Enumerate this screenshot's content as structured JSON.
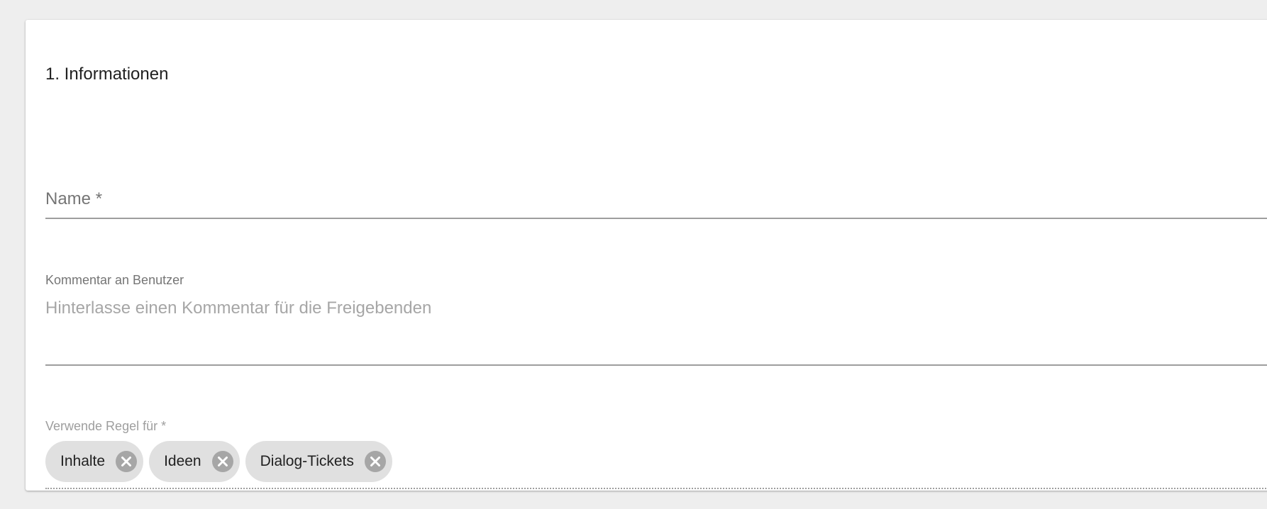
{
  "section": {
    "title": "1. Informationen"
  },
  "name_field": {
    "label": "Name *",
    "value": ""
  },
  "comment_field": {
    "label": "Kommentar an Benutzer",
    "placeholder": "Hinterlasse einen Kommentar für die Freigebenden",
    "value": ""
  },
  "rule_field": {
    "label": "Verwende Regel für *",
    "chips": [
      {
        "label": "Inhalte",
        "remove_icon": "cancel-circle-icon"
      },
      {
        "label": "Ideen",
        "remove_icon": "cancel-circle-icon"
      },
      {
        "label": "Dialog-Tickets",
        "remove_icon": "cancel-circle-icon"
      }
    ]
  },
  "colors": {
    "page_background": "#eeeeee",
    "card_background": "#ffffff",
    "chip_background": "#e0e0e0",
    "chip_remove_icon": "#a6a6a6",
    "label_text": "#757575",
    "placeholder_text": "#a6a6a6"
  }
}
